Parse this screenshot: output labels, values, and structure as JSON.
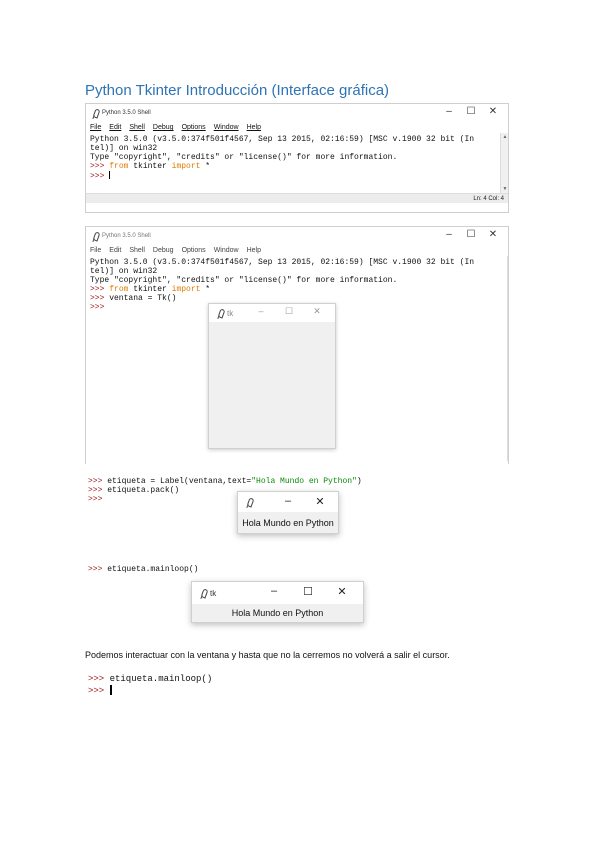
{
  "doc": {
    "title": "Python Tkinter Introducción (Interface gráfica)",
    "paragraph": "Podemos interactuar con la ventana y hasta que no la cerremos no volverá a salir el cursor."
  },
  "shell1": {
    "title": "Python 3.5.0 Shell",
    "controls": {
      "minimize": "–",
      "maximize": "☐",
      "close": "✕"
    },
    "menu": [
      "File",
      "Edit",
      "Shell",
      "Debug",
      "Options",
      "Window",
      "Help"
    ],
    "lines": {
      "l1": "Python 3.5.0 (v3.5.0:374f501f4567, Sep 13 2015, 02:16:59) [MSC v.1900 32 bit (In",
      "l2": "tel)] on win32",
      "l3": "Type \"copyright\", \"credits\" or \"license()\" for more information.",
      "prompt": ">>>",
      "l4_kw1": "from",
      "l4_mod": " tkinter ",
      "l4_kw2": "import",
      "l4_rest": " *"
    },
    "status": "Ln: 4  Col: 4"
  },
  "shell2": {
    "title": "Python 3.5.0 Shell",
    "menu": [
      "File",
      "Edit",
      "Shell",
      "Debug",
      "Options",
      "Window",
      "Help"
    ],
    "lines": {
      "l1": "Python 3.5.0 (v3.5.0:374f501f4567, Sep 13 2015, 02:16:59) [MSC v.1900 32 bit (In",
      "l2": "tel)] on win32",
      "l3": "Type \"copyright\", \"credits\" or \"license()\" for more information.",
      "prompt": ">>>",
      "l4_kw1": "from",
      "l4_mod": " tkinter ",
      "l4_kw2": "import",
      "l4_rest": " *",
      "l5": " ventana = Tk()"
    },
    "tk_title": "tk"
  },
  "snippet1": {
    "prompt": ">>>",
    "l1_code": " etiqueta = Label(ventana,text=",
    "l1_str": "\"Hola Mundo en Python\"",
    "l1_end": ")",
    "l2_code": " etiqueta.pack()"
  },
  "tk_small": {
    "label": "Hola Mundo en Python"
  },
  "snippet2": {
    "prompt": ">>>",
    "code": " etiqueta.mainloop()"
  },
  "tk_wide": {
    "title": "tk",
    "label": "Hola Mundo en Python"
  },
  "snippet3": {
    "prompt": ">>>",
    "code": " etiqueta.mainloop()"
  }
}
